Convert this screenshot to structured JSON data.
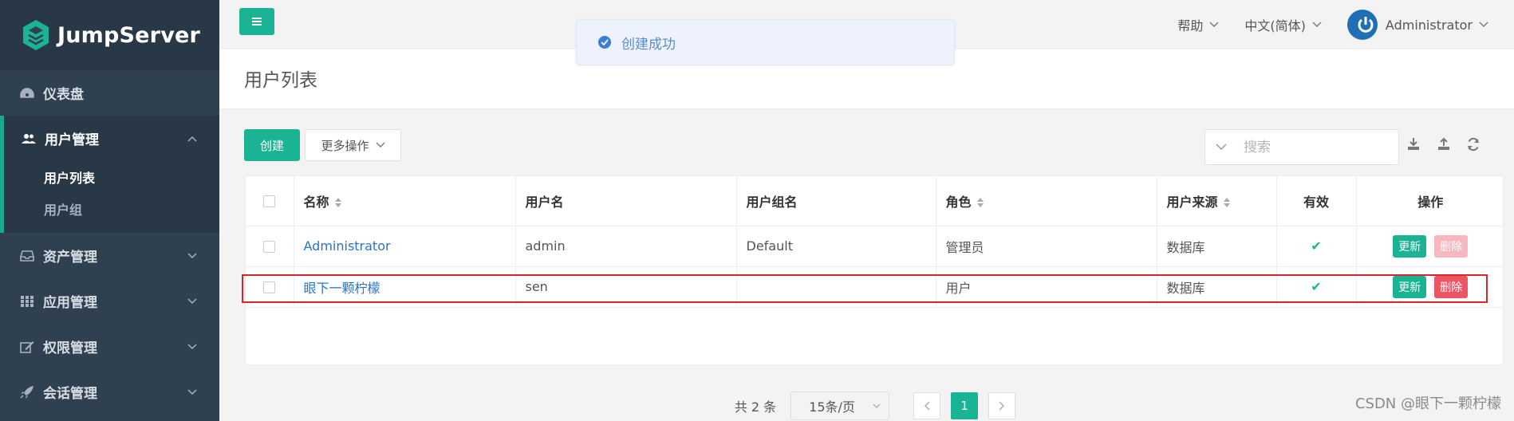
{
  "app": {
    "name": "JumpServer"
  },
  "sidebar": {
    "items": [
      {
        "label": "仪表盘",
        "icon": "dashboard-icon"
      },
      {
        "label": "用户管理",
        "icon": "users-icon",
        "open": true,
        "children": [
          {
            "label": "用户列表",
            "active": true
          },
          {
            "label": "用户组"
          }
        ]
      },
      {
        "label": "资产管理",
        "icon": "inbox-icon"
      },
      {
        "label": "应用管理",
        "icon": "grid-icon"
      },
      {
        "label": "权限管理",
        "icon": "edit-icon"
      },
      {
        "label": "会话管理",
        "icon": "rocket-icon"
      }
    ]
  },
  "topbar": {
    "help": "帮助",
    "language": "中文(简体)",
    "user": "Administrator"
  },
  "toast": {
    "message": "创建成功",
    "type": "success"
  },
  "page": {
    "title": "用户列表"
  },
  "toolbar": {
    "create_label": "创建",
    "more_label": "更多操作",
    "search_placeholder": "搜索"
  },
  "table": {
    "columns": [
      "名称",
      "用户名",
      "用户组名",
      "角色",
      "用户来源",
      "有效",
      "操作"
    ],
    "rows": [
      {
        "name": "Administrator",
        "username": "admin",
        "group": "Default",
        "role": "管理员",
        "source": "数据库",
        "valid": "✔",
        "update": "更新",
        "delete": "删除"
      },
      {
        "name": "眼下一颗柠檬",
        "username": "sen",
        "group": "",
        "role": "用户",
        "source": "数据库",
        "valid": "✔",
        "update": "更新",
        "delete": "删除"
      }
    ]
  },
  "pagination": {
    "total": "共 2 条",
    "page_size": "15条/页",
    "current": "1"
  },
  "watermark": "CSDN @眼下一颗柠檬",
  "colors": {
    "accent": "#1ab394",
    "sidebar": "#2f4050",
    "danger": "#ed5565",
    "link": "#2a74c6"
  }
}
